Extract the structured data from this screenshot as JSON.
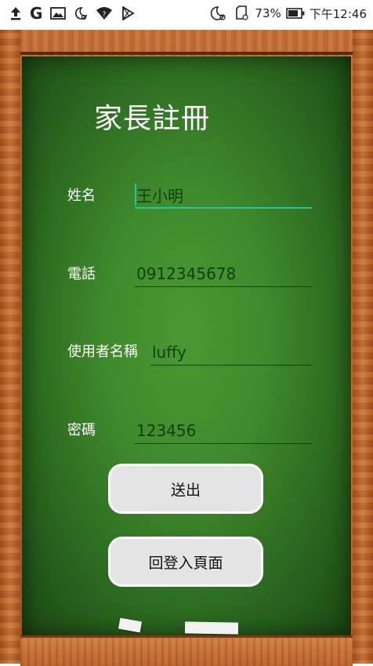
{
  "status_bar": {
    "icons": [
      "upload-icon",
      "google-icon",
      "image-icon",
      "do-not-disturb-icon",
      "wifi-question-icon",
      "play-store-icon",
      "do-not-disturb-icon",
      "sd-card-icon",
      "battery-icon"
    ],
    "google_letter": "G",
    "battery_percent": "73%",
    "time": "下午12:46"
  },
  "form": {
    "title": "家長註冊",
    "fields": [
      {
        "label": "姓名",
        "value": "王小明"
      },
      {
        "label": "電話",
        "value": "0912345678"
      },
      {
        "label": "使用者名稱",
        "value": "luffy"
      },
      {
        "label": "密碼",
        "value": "123456"
      }
    ],
    "submit_label": "送出",
    "back_label": "回登入頁面"
  },
  "colors": {
    "board_green": "#3f8a2c",
    "frame_wood": "#c06a30",
    "focus_accent": "#1fc7a4",
    "button_bg": "#e4e4e4"
  }
}
